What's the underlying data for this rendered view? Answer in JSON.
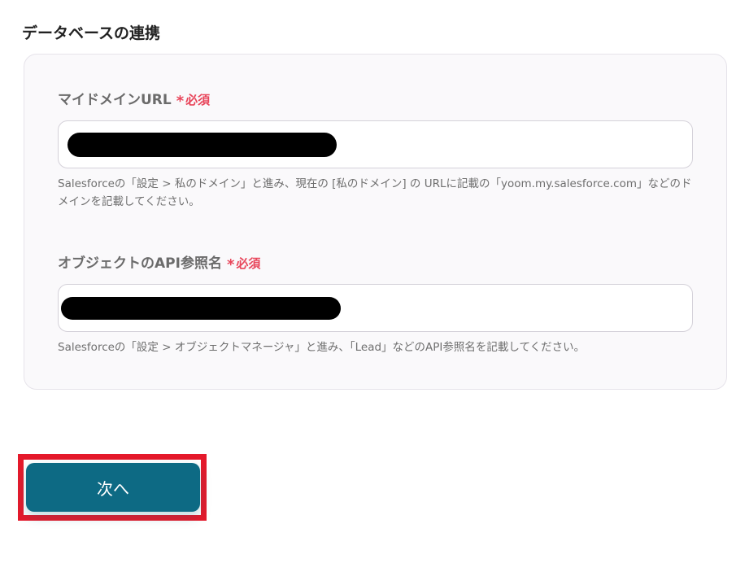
{
  "section": {
    "title": "データベースの連携"
  },
  "fields": [
    {
      "label": "マイドメインURL",
      "required_mark": "*",
      "required_text": "必須",
      "value": "",
      "help": "Salesforceの「設定 > 私のドメイン」と進み、現在の [私のドメイン] の URLに記載の「yoom.my.salesforce.com」などのドメインを記載してください。"
    },
    {
      "label": "オブジェクトのAPI参照名",
      "required_mark": "*",
      "required_text": "必須",
      "value": "",
      "help": "Salesforceの「設定 > オブジェクトマネージャ」と進み、「Lead」などのAPI参照名を記載してください。"
    }
  ],
  "actions": {
    "next_label": "次へ"
  },
  "colors": {
    "accent": "#0d6a84",
    "required": "#e8455a",
    "highlight_outline": "#e5192b"
  }
}
